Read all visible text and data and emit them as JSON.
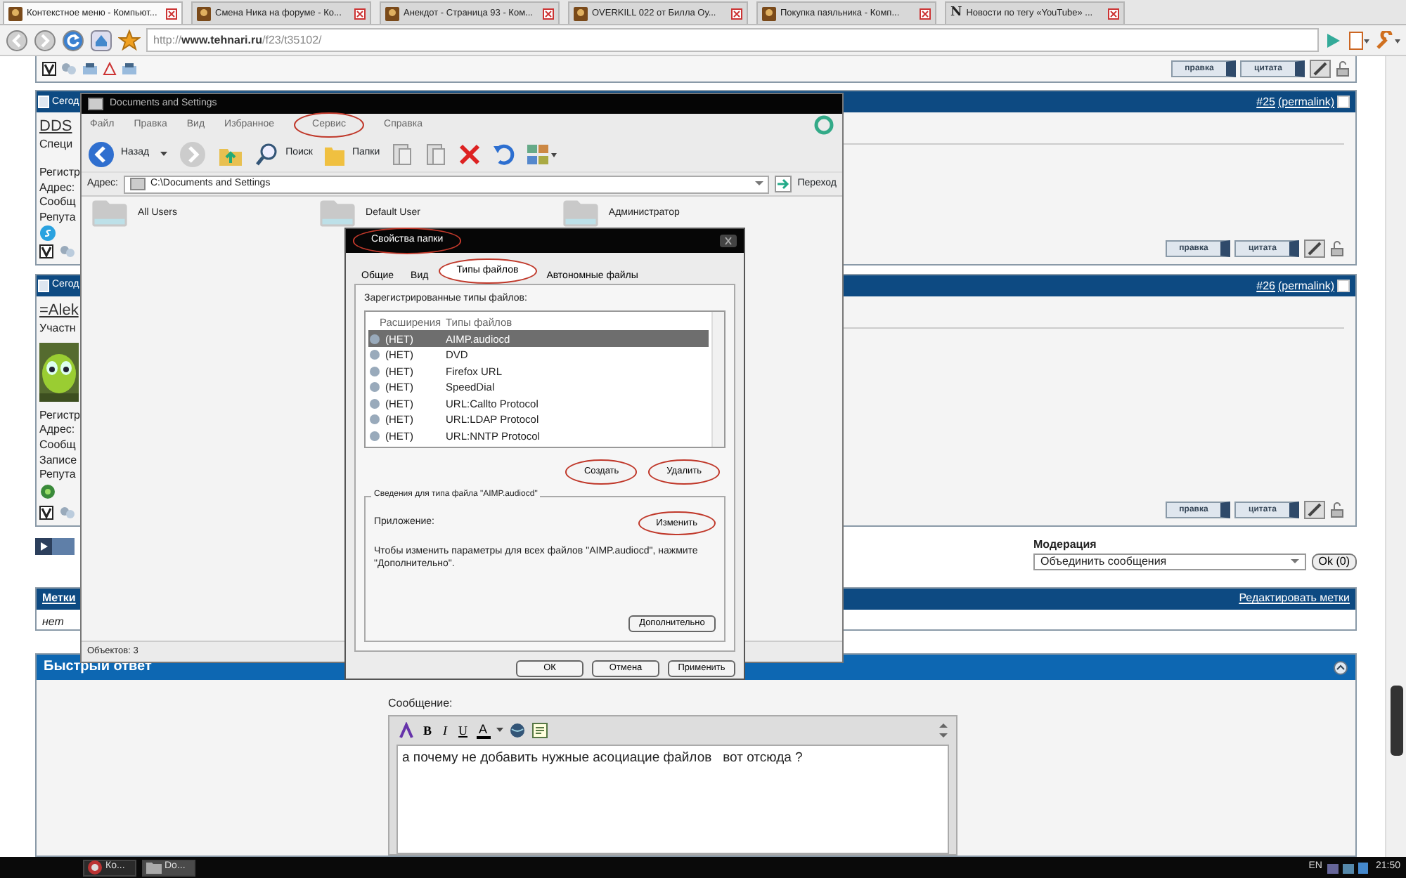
{
  "browser": {
    "tabs": [
      {
        "title": "Контекстное меню - Компьют...",
        "selected": true
      },
      {
        "title": "Смена Ника на форуме - Ко...",
        "selected": false
      },
      {
        "title": "Анекдот - Страница 93 - Ком...",
        "selected": false
      },
      {
        "title": "OVERKILL 022 от Билла Оу...",
        "selected": false
      },
      {
        "title": "Покупка паяльника - Комп...",
        "selected": false
      },
      {
        "title": "Новости по тегу «YouTube» ...",
        "favicon_text": "N",
        "selected": false
      }
    ],
    "url": "http://**www.tehnari.ru**/f23/t35102/"
  },
  "forum": {
    "top_post": {
      "buttons": [
        "правка",
        "цитата"
      ]
    },
    "posts": [
      {
        "header": "Сегод",
        "number": "#25",
        "permalink": "(permalink)",
        "checked": false,
        "username": "DDS",
        "user_lines": [
          "Специ"
        ],
        "details": [
          "Регистр",
          "Адрес:",
          "Сообщ",
          "Репута"
        ],
        "avatar": false,
        "buttons": [
          "правка",
          "цитата"
        ]
      },
      {
        "header": "Сегод",
        "number": "#26",
        "permalink": "(permalink)",
        "checked": false,
        "username": "=Alek",
        "user_lines": [
          "Участн"
        ],
        "details": [
          "Регистр",
          "Адрес:",
          "Сообщ",
          "Записе",
          "Репута"
        ],
        "avatar": true,
        "buttons": [
          "правка",
          "цитата"
        ]
      }
    ],
    "moderation": {
      "label": "Модерация",
      "select": "Объединить сообщения",
      "button": "Ok (0)"
    },
    "tags": {
      "title": "Метки",
      "edit_link": "Редактировать метки",
      "value": "нет"
    },
    "quick_reply": {
      "title": "Быстрый ответ",
      "label": "Сообщение:",
      "format_buttons": [
        "B",
        "I",
        "U",
        "A"
      ],
      "message": "а почему не добавить нужные асоциацие файлов   вот отсюда ?"
    }
  },
  "explorer": {
    "title": "Documents and Settings",
    "menu": [
      {
        "label": "Файл",
        "circled": false
      },
      {
        "label": "Правка",
        "circled": false
      },
      {
        "label": "Вид",
        "circled": false
      },
      {
        "label": "Избранное",
        "circled": false
      },
      {
        "label": "Сервис",
        "circled": true
      },
      {
        "label": "Справка",
        "circled": false
      }
    ],
    "back": "Назад",
    "search": "Поиск",
    "folders_button": "Папки",
    "address_label": "Адрес:",
    "address": "C:\\Documents and Settings",
    "go": "Переход",
    "folders": [
      "All Users",
      "Default User",
      "Администратор"
    ],
    "status": "Объектов: 3"
  },
  "dialog": {
    "title": "Свойства папки",
    "title_circled": true,
    "tabs": [
      {
        "label": "Общие",
        "selected": false,
        "circled": false
      },
      {
        "label": "Вид",
        "selected": false,
        "circled": false
      },
      {
        "label": "Типы файлов",
        "selected": true,
        "circled": true
      },
      {
        "label": "Автономные файлы",
        "selected": false,
        "circled": false
      }
    ],
    "list_label": "Зарегистрированные типы файлов:",
    "columns": [
      "Расширения",
      "Типы файлов"
    ],
    "rows": [
      {
        "extension": "(НЕТ)",
        "type": "AIMP.audiocd",
        "selected": true
      },
      {
        "extension": "(НЕТ)",
        "type": "DVD",
        "selected": false
      },
      {
        "extension": "(НЕТ)",
        "type": "Firefox URL",
        "selected": false
      },
      {
        "extension": "(НЕТ)",
        "type": "SpeedDial",
        "selected": false
      },
      {
        "extension": "(НЕТ)",
        "type": "URL:Callto Protocol",
        "selected": false
      },
      {
        "extension": "(НЕТ)",
        "type": "URL:LDAP Protocol",
        "selected": false
      },
      {
        "extension": "(НЕТ)",
        "type": "URL:NNTP Protocol",
        "selected": false
      }
    ],
    "buttons": [
      {
        "label": "Создать",
        "circled": true
      },
      {
        "label": "Удалить",
        "circled": true
      }
    ],
    "details": {
      "legend": "Сведения для типа файла \"AIMP.audiocd\"",
      "app_label": "Приложение:",
      "change_button": {
        "label": "Изменить",
        "circled": true
      },
      "text": "Чтобы изменить параметры для всех файлов \"AIMP.audiocd\", нажмите \"Дополнительно\".",
      "advanced_button": "Дополнительно"
    },
    "footer": [
      "ОК",
      "Отмена",
      "Применить"
    ]
  },
  "taskbar": {
    "items": [
      {
        "label": "Ко...",
        "selected": false
      },
      {
        "label": "Do...",
        "selected": true
      }
    ],
    "lang": "EN",
    "clock": "21:50"
  }
}
